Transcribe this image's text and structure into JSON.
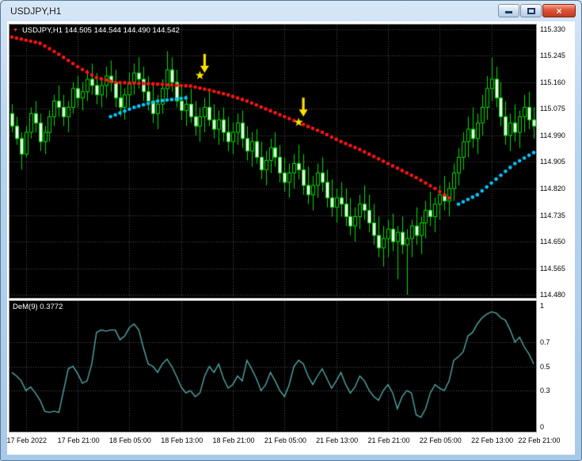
{
  "window": {
    "title": "USDJPY,H1",
    "controls": {
      "close_glyph": "×"
    }
  },
  "chart": {
    "info_marker": "▼",
    "info_line": "USDJPY,H1 144.505 144.544 144.490 144.542",
    "price_axis": {
      "max": 115.345,
      "min": 114.47,
      "labels": [
        "115.330",
        "115.245",
        "115.160",
        "115.075",
        "114.990",
        "114.905",
        "114.820",
        "114.735",
        "114.650",
        "114.565",
        "114.480"
      ]
    },
    "time_axis": {
      "labels": [
        "17 Feb 2022",
        "17 Feb 21:00",
        "18 Feb 05:00",
        "18 Feb 13:00",
        "18 Feb 21:00",
        "21 Feb 05:00",
        "21 Feb 13:00",
        "21 Feb 21:00",
        "22 Feb 05:00",
        "22 Feb 13:00",
        "22 Feb 21:00"
      ],
      "tick_bars": [
        3,
        14,
        25,
        36,
        47,
        58,
        69,
        80,
        91,
        102,
        112
      ]
    },
    "colors": {
      "background": "#000000",
      "grid": "#515151",
      "candle_outline": "#00dc00",
      "bull_fill": "#000000",
      "bear_fill": "#f2f2f2",
      "trend_down": "#ff1414",
      "trend_up": "#00c8ff",
      "signal": "#ffdf00",
      "indicator_line": "#4fa8a8"
    },
    "candles": [
      [
        115.06,
        115.09,
        115.0,
        115.02
      ],
      [
        115.02,
        115.05,
        114.96,
        114.98
      ],
      [
        114.98,
        115.0,
        114.88,
        114.93
      ],
      [
        114.93,
        115.02,
        114.92,
        115.0
      ],
      [
        115.0,
        115.08,
        114.98,
        115.06
      ],
      [
        115.06,
        115.1,
        115.0,
        115.03
      ],
      [
        115.03,
        115.06,
        114.94,
        114.97
      ],
      [
        114.97,
        115.02,
        114.93,
        115.0
      ],
      [
        115.0,
        115.07,
        114.97,
        115.05
      ],
      [
        115.05,
        115.12,
        115.02,
        115.1
      ],
      [
        115.1,
        115.15,
        115.05,
        115.08
      ],
      [
        115.08,
        115.12,
        115.02,
        115.05
      ],
      [
        115.05,
        115.1,
        115.0,
        115.08
      ],
      [
        115.08,
        115.16,
        115.06,
        115.14
      ],
      [
        115.14,
        115.18,
        115.08,
        115.11
      ],
      [
        115.11,
        115.16,
        115.07,
        115.13
      ],
      [
        115.13,
        115.2,
        115.1,
        115.17
      ],
      [
        115.17,
        115.22,
        115.12,
        115.15
      ],
      [
        115.15,
        115.19,
        115.09,
        115.12
      ],
      [
        115.12,
        115.17,
        115.08,
        115.15
      ],
      [
        115.15,
        115.21,
        115.11,
        115.18
      ],
      [
        115.18,
        115.23,
        115.13,
        115.16
      ],
      [
        115.16,
        115.2,
        115.08,
        115.11
      ],
      [
        115.11,
        115.16,
        115.05,
        115.08
      ],
      [
        115.08,
        115.14,
        115.04,
        115.12
      ],
      [
        115.12,
        115.19,
        115.08,
        115.16
      ],
      [
        115.16,
        115.22,
        115.12,
        115.19
      ],
      [
        115.19,
        115.24,
        115.14,
        115.17
      ],
      [
        115.17,
        115.21,
        115.1,
        115.13
      ],
      [
        115.13,
        115.18,
        115.07,
        115.1
      ],
      [
        115.1,
        115.15,
        115.03,
        115.06
      ],
      [
        115.06,
        115.12,
        115.01,
        115.09
      ],
      [
        115.09,
        115.17,
        115.06,
        115.14
      ],
      [
        115.14,
        115.26,
        115.11,
        115.2
      ],
      [
        115.2,
        115.24,
        115.13,
        115.16
      ],
      [
        115.16,
        115.2,
        115.08,
        115.1
      ],
      [
        115.1,
        115.15,
        115.04,
        115.07
      ],
      [
        115.07,
        115.12,
        115.02,
        115.09
      ],
      [
        115.09,
        115.14,
        115.03,
        115.05
      ],
      [
        115.05,
        115.1,
        114.99,
        115.02
      ],
      [
        115.02,
        115.08,
        114.97,
        115.05
      ],
      [
        115.05,
        115.11,
        115.0,
        115.08
      ],
      [
        115.08,
        115.13,
        115.02,
        115.04
      ],
      [
        115.04,
        115.09,
        114.98,
        115.01
      ],
      [
        115.01,
        115.07,
        114.96,
        115.04
      ],
      [
        115.04,
        115.08,
        114.97,
        115.0
      ],
      [
        115.0,
        115.05,
        114.94,
        114.97
      ],
      [
        114.97,
        115.03,
        114.93,
        115.0
      ],
      [
        115.0,
        115.06,
        114.96,
        115.03
      ],
      [
        115.03,
        115.07,
        114.95,
        114.98
      ],
      [
        114.98,
        115.02,
        114.91,
        114.94
      ],
      [
        114.94,
        115.0,
        114.89,
        114.97
      ],
      [
        114.97,
        115.01,
        114.9,
        114.92
      ],
      [
        114.92,
        114.97,
        114.85,
        114.88
      ],
      [
        114.88,
        114.94,
        114.83,
        114.91
      ],
      [
        114.91,
        114.98,
        114.87,
        114.95
      ],
      [
        114.95,
        115.0,
        114.89,
        114.92
      ],
      [
        114.92,
        114.96,
        114.84,
        114.87
      ],
      [
        114.87,
        114.92,
        114.81,
        114.84
      ],
      [
        114.84,
        114.9,
        114.79,
        114.87
      ],
      [
        114.87,
        114.93,
        114.82,
        114.9
      ],
      [
        114.9,
        114.96,
        114.85,
        114.88
      ],
      [
        114.88,
        114.93,
        114.8,
        114.83
      ],
      [
        114.83,
        114.89,
        114.77,
        114.8
      ],
      [
        114.8,
        114.86,
        114.75,
        114.83
      ],
      [
        114.83,
        114.9,
        114.79,
        114.87
      ],
      [
        114.87,
        114.92,
        114.81,
        114.84
      ],
      [
        114.84,
        114.88,
        114.76,
        114.79
      ],
      [
        114.79,
        114.85,
        114.73,
        114.76
      ],
      [
        114.76,
        114.82,
        114.71,
        114.79
      ],
      [
        114.79,
        114.84,
        114.73,
        114.77
      ],
      [
        114.77,
        114.82,
        114.7,
        114.73
      ],
      [
        114.73,
        114.79,
        114.67,
        114.7
      ],
      [
        114.7,
        114.76,
        114.65,
        114.73
      ],
      [
        114.73,
        114.8,
        114.69,
        114.77
      ],
      [
        114.77,
        114.83,
        114.72,
        114.75
      ],
      [
        114.75,
        114.8,
        114.68,
        114.71
      ],
      [
        114.71,
        114.77,
        114.64,
        114.67
      ],
      [
        114.67,
        114.73,
        114.6,
        114.63
      ],
      [
        114.63,
        114.7,
        114.57,
        114.66
      ],
      [
        114.66,
        114.72,
        114.6,
        114.69
      ],
      [
        114.69,
        114.74,
        114.62,
        114.65
      ],
      [
        114.65,
        114.7,
        114.53,
        114.68
      ],
      [
        114.68,
        114.73,
        114.61,
        114.64
      ],
      [
        114.64,
        114.69,
        114.48,
        114.66
      ],
      [
        114.66,
        114.72,
        114.6,
        114.7
      ],
      [
        114.7,
        114.76,
        114.64,
        114.67
      ],
      [
        114.67,
        114.73,
        114.61,
        114.71
      ],
      [
        114.71,
        114.78,
        114.66,
        114.75
      ],
      [
        114.75,
        114.81,
        114.7,
        114.73
      ],
      [
        114.73,
        114.79,
        114.68,
        114.77
      ],
      [
        114.77,
        114.83,
        114.72,
        114.8
      ],
      [
        114.8,
        114.86,
        114.75,
        114.78
      ],
      [
        114.78,
        114.84,
        114.73,
        114.82
      ],
      [
        114.82,
        114.9,
        114.78,
        114.87
      ],
      [
        114.87,
        114.95,
        114.83,
        114.92
      ],
      [
        114.92,
        115.0,
        114.88,
        114.97
      ],
      [
        114.97,
        115.05,
        114.92,
        115.01
      ],
      [
        115.01,
        115.08,
        114.95,
        114.98
      ],
      [
        114.98,
        115.06,
        114.93,
        115.03
      ],
      [
        115.03,
        115.12,
        114.99,
        115.08
      ],
      [
        115.08,
        115.18,
        115.04,
        115.14
      ],
      [
        115.14,
        115.24,
        115.1,
        115.17
      ],
      [
        115.17,
        115.21,
        115.08,
        115.11
      ],
      [
        115.11,
        115.16,
        115.02,
        115.05
      ],
      [
        115.05,
        115.1,
        114.96,
        114.99
      ],
      [
        114.99,
        115.06,
        114.94,
        115.03
      ],
      [
        115.03,
        115.09,
        114.97,
        115.0
      ],
      [
        115.0,
        115.07,
        114.95,
        115.05
      ],
      [
        115.05,
        115.12,
        115.0,
        115.08
      ],
      [
        115.08,
        115.13,
        115.01,
        115.04
      ],
      [
        115.04,
        115.08,
        114.98,
        115.02
      ]
    ],
    "trend_down_anchors": [
      [
        0,
        115.305
      ],
      [
        6,
        115.285
      ],
      [
        10,
        115.25
      ],
      [
        14,
        115.21
      ],
      [
        18,
        115.175
      ],
      [
        22,
        115.16
      ],
      [
        30,
        115.155
      ],
      [
        38,
        115.148
      ],
      [
        42,
        115.135
      ],
      [
        46,
        115.12
      ],
      [
        50,
        115.1
      ],
      [
        54,
        115.075
      ],
      [
        58,
        115.05
      ],
      [
        62,
        115.025
      ],
      [
        66,
        115.0
      ],
      [
        70,
        114.97
      ],
      [
        74,
        114.945
      ],
      [
        78,
        114.915
      ],
      [
        82,
        114.885
      ],
      [
        86,
        114.855
      ],
      [
        90,
        114.82
      ],
      [
        93,
        114.79
      ]
    ],
    "trend_up_segments": [
      [
        [
          21,
          115.05
        ],
        [
          26,
          115.08
        ],
        [
          31,
          115.1
        ],
        [
          37,
          115.11
        ]
      ],
      [
        [
          95,
          114.77
        ],
        [
          99,
          114.8
        ],
        [
          103,
          114.85
        ],
        [
          107,
          114.9
        ],
        [
          111,
          114.935
        ]
      ]
    ],
    "signals": [
      {
        "bar": 41,
        "tip": 115.19,
        "star_bar": 40,
        "star": 115.182
      },
      {
        "bar": 62,
        "tip": 115.05,
        "star_bar": 61,
        "star": 115.032
      }
    ]
  },
  "indicator": {
    "label": "DeM(9) 0.3772",
    "axis_labels": [
      "1",
      "0.7",
      "0.5",
      "0.3",
      "0"
    ],
    "grid_values": [
      0.7,
      0.5,
      0.3
    ],
    "max": 1,
    "min": 0,
    "values": [
      0.45,
      0.42,
      0.38,
      0.3,
      0.33,
      0.28,
      0.22,
      0.13,
      0.12,
      0.13,
      0.12,
      0.3,
      0.48,
      0.5,
      0.44,
      0.36,
      0.38,
      0.52,
      0.78,
      0.8,
      0.79,
      0.8,
      0.8,
      0.72,
      0.75,
      0.82,
      0.85,
      0.8,
      0.65,
      0.52,
      0.5,
      0.45,
      0.52,
      0.56,
      0.5,
      0.42,
      0.33,
      0.28,
      0.3,
      0.25,
      0.28,
      0.42,
      0.5,
      0.45,
      0.52,
      0.4,
      0.32,
      0.35,
      0.42,
      0.38,
      0.55,
      0.48,
      0.4,
      0.3,
      0.35,
      0.45,
      0.38,
      0.3,
      0.25,
      0.35,
      0.5,
      0.55,
      0.52,
      0.42,
      0.35,
      0.42,
      0.48,
      0.4,
      0.32,
      0.38,
      0.45,
      0.35,
      0.28,
      0.33,
      0.42,
      0.38,
      0.3,
      0.25,
      0.22,
      0.3,
      0.35,
      0.28,
      0.15,
      0.25,
      0.3,
      0.28,
      0.1,
      0.08,
      0.15,
      0.28,
      0.35,
      0.32,
      0.3,
      0.38,
      0.55,
      0.58,
      0.62,
      0.75,
      0.78,
      0.85,
      0.9,
      0.93,
      0.95,
      0.94,
      0.9,
      0.88,
      0.8,
      0.7,
      0.74,
      0.66,
      0.6,
      0.52
    ]
  }
}
